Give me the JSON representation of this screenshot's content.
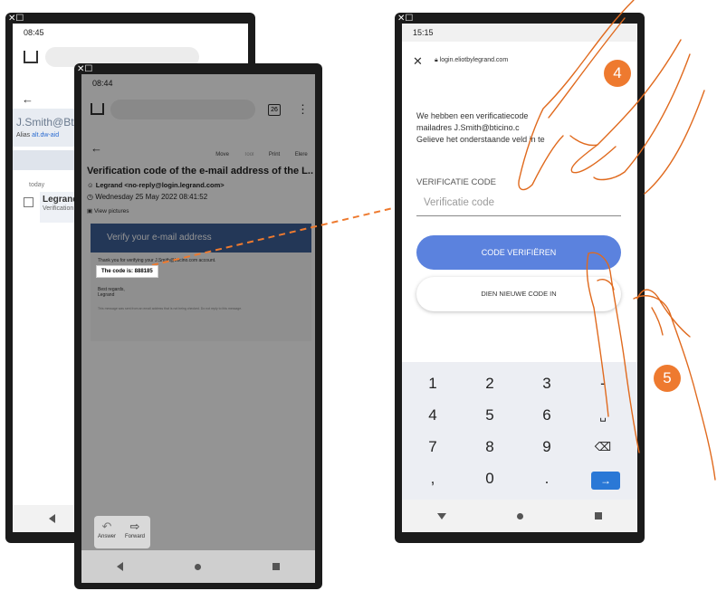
{
  "left_phone": {
    "corner_icon": "✕☐",
    "time": "08:45",
    "account": "J.Smith@Bti",
    "alias_label": "Alias",
    "alias_value": "alt.dw-aid",
    "section": "today",
    "sender": "Legrand",
    "preview": "Verification"
  },
  "middle_phone": {
    "corner_icon": "✕☐",
    "time": "08:44",
    "tab_count": "26",
    "toolbar": [
      "Move",
      "Tool",
      "Print",
      "Elere"
    ],
    "subject": "Verification code of the e-mail address of the L...",
    "from": "Legrand <no-reply@login.legrand.com>",
    "date": "Wednesday 25 May 2022 08:41:52",
    "view_pictures": "View pictures",
    "email_banner": "Verify your e-mail address",
    "email_thanks": "Thank you for verifying your J.Smith@bticino.com account.",
    "code_line": "The code is: 888185",
    "regards": "Best regards,",
    "signature": "Legrand",
    "footer": "This message was sent from an email address that is not being checked. Do not reply to this message.",
    "answer": "Answer",
    "forward": "Forward"
  },
  "right_phone": {
    "corner_icon": "✕☐",
    "time": "15:15",
    "url": "login.eliotbylegrand.com",
    "info_line1": "We hebben een verificatiecode",
    "info_line2": "mailadres J.Smith@bticino.c",
    "info_line3": "Gelieve het onderstaande veld in te",
    "field_label": "VERIFICATIE CODE",
    "field_placeholder": "Verificatie code",
    "verify_button": "CODE VERIFIËREN",
    "new_code_button": "DIEN NIEUWE CODE IN",
    "keypad": [
      "1",
      "2",
      "3",
      "-",
      "4",
      "5",
      "6",
      "␣",
      "7",
      "8",
      "9",
      "⌫",
      ",",
      "0",
      ".",
      "→"
    ]
  },
  "steps": {
    "step4": "4",
    "step5": "5"
  },
  "colors": {
    "accent_orange": "#ee7a2f",
    "button_blue": "#5b82de",
    "email_banner": "#3d5f97"
  }
}
